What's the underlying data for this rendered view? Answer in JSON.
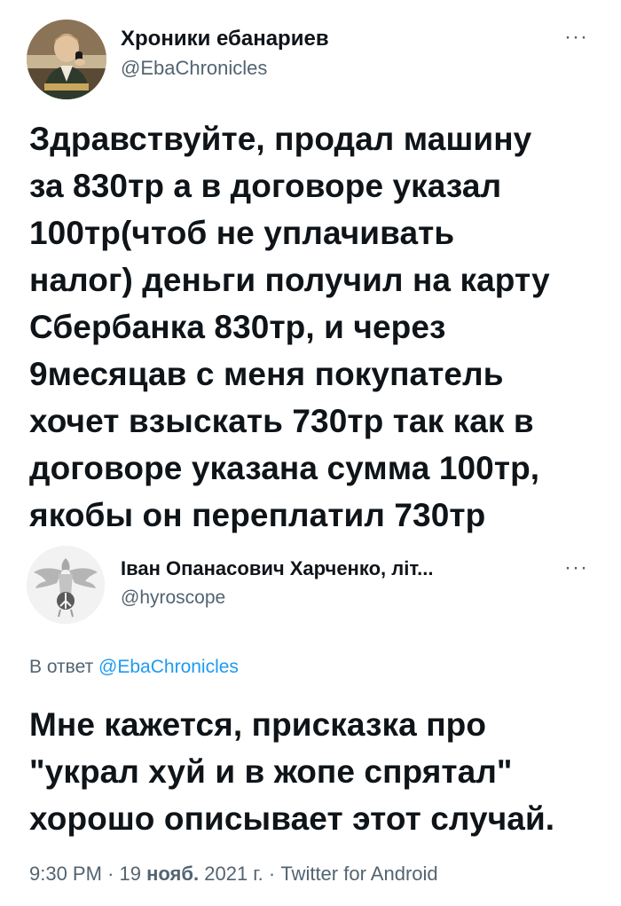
{
  "original_tweet": {
    "author_name": "Хроники ебанариев",
    "author_handle": "@EbaChronicles",
    "more_label": "···",
    "text": "Здравствуйте, продал машину за 830тр а в договоре указал 100тр(чтоб не уплачивать налог) деньги получил на карту Сбербанка 830тр, и через 9месяцав с меня покупатель хочет взыскать 730тр так как в договоре указана сумма 100тр, якобы он переплатил 730тр",
    "lines": [
      "Здравствуйте, продал машину",
      "за 830тр а в договоре указал",
      "100тр(чтоб не уплачивать",
      "налог) деньги получил на карту",
      "Сбербанка 830тр, и через",
      "9месяцав с меня покупатель",
      "хочет взыскать 730тр так как в",
      "договоре указана сумма 100тр,",
      "якобы он переплатил 730тр"
    ]
  },
  "reply_tweet": {
    "author_name": "Іван Опанасович Харченко, літ...",
    "author_handle": "@hyroscope",
    "more_label": "···",
    "reply_prefix": "В ответ",
    "reply_to": "@EbaChronicles",
    "lines": [
      "Мне кажется, присказка про",
      "\"украл хуй и в жопе спрятал\"",
      "хорошо описывает этот случай."
    ],
    "time": "9:30 PM",
    "separator": "·",
    "date_day": "19",
    "date_month": "нояб.",
    "date_year": "2021 г.",
    "source": "Twitter for Android"
  },
  "colors": {
    "text": "#0f1419",
    "secondary": "#536471",
    "link": "#1d9bf0"
  }
}
